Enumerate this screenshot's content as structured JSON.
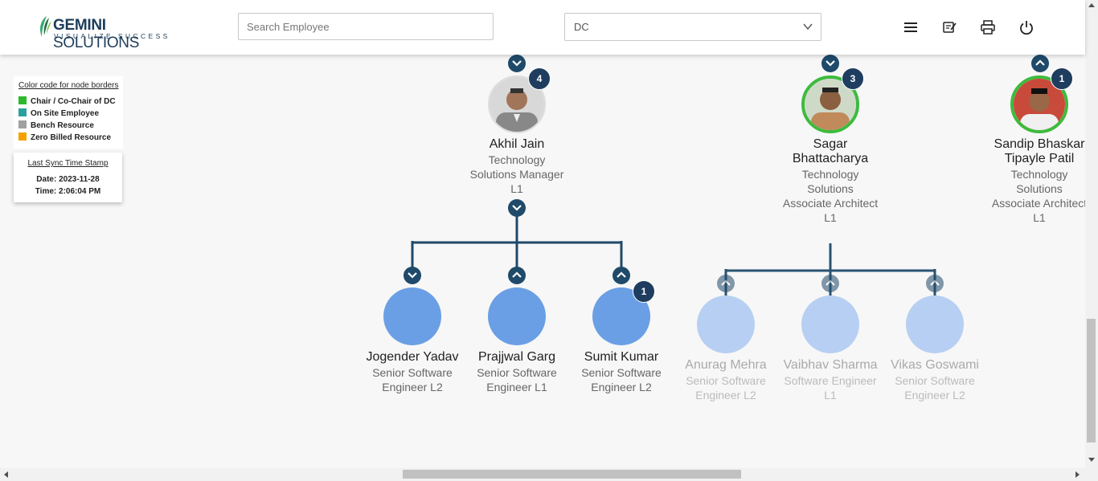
{
  "header": {
    "logo_brand": "GEMINI",
    "logo_brand_suffix": "SOLUTIONS",
    "logo_tagline": "VISUALIZE SUCCESS",
    "search_placeholder": "Search Employee",
    "dc_select_value": "DC",
    "icons": [
      "menu-icon",
      "notes-icon",
      "print-icon",
      "power-icon"
    ]
  },
  "legend": {
    "title": "Color code for node borders",
    "items": [
      {
        "label": "Chair / Co-Chair of DC",
        "color": "#2db82d"
      },
      {
        "label": "On Site Employee",
        "color": "#2aa0a0"
      },
      {
        "label": "Bench Resource",
        "color": "#a0a0a0"
      },
      {
        "label": "Zero Billed Resource",
        "color": "#f5a000"
      }
    ]
  },
  "sync": {
    "title": "Last Sync Time Stamp",
    "date": "Date: 2023-11-28",
    "time": "Time: 2:06:04 PM"
  },
  "nodes": {
    "akhil": {
      "name": "Akhil Jain",
      "line1": "Technology",
      "line2": "Solutions Manager",
      "line3": "L1",
      "badge": "4"
    },
    "sagar": {
      "name1": "Sagar",
      "name2": "Bhattacharya",
      "line1": "Technology",
      "line2": "Solutions",
      "line3": "Associate Architect",
      "line4": "L1",
      "badge": "3"
    },
    "sandip": {
      "name1": "Sandip Bhaskar",
      "name2": "Tipayle Patil",
      "line1": "Technology",
      "line2": "Solutions",
      "line3": "Associate Architect",
      "line4": "L1",
      "badge": "1"
    },
    "jogender": {
      "name": "Jogender Yadav",
      "line1": "Senior Software",
      "line2": "Engineer L2"
    },
    "prajjwal": {
      "name": "Prajjwal Garg",
      "line1": "Senior Software",
      "line2": "Engineer L1"
    },
    "sumit": {
      "name": "Sumit Kumar",
      "line1": "Senior Software",
      "line2": "Engineer L2",
      "badge": "1"
    },
    "anurag": {
      "name": "Anurag Mehra",
      "line1": "Senior Software",
      "line2": "Engineer L2"
    },
    "vaibhav": {
      "name": "Vaibhav Sharma",
      "line1": "Software Engineer",
      "line2": "L1"
    },
    "vikas": {
      "name": "Vikas Goswami",
      "line1": "Senior Software",
      "line2": "Engineer L2"
    }
  },
  "colors": {
    "connector": "#1f4a6a",
    "chair_border": "#3dbb3d",
    "avatar_fill": "#6a9fe5",
    "avatar_fill_faded": "#b7cff2"
  }
}
